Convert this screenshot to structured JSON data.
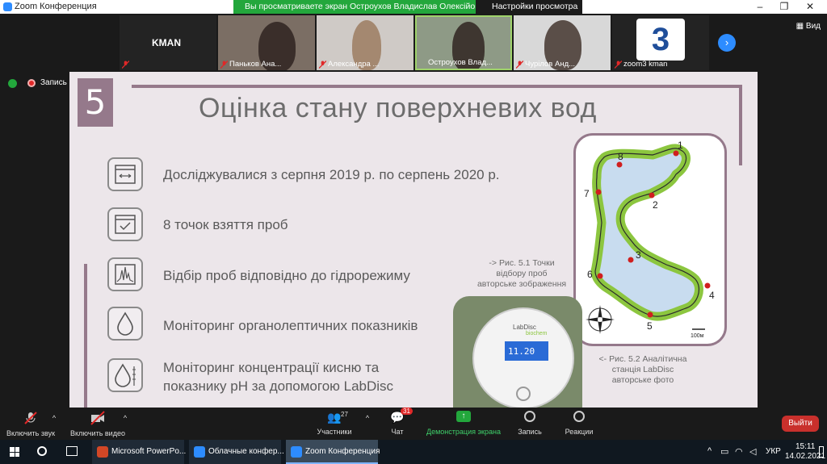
{
  "window": {
    "title": "Zoom Конференция"
  },
  "share_bar": {
    "message": "Вы просматриваете экран Остроухов Владислав Олексійови...",
    "view_options": "Настройки просмотра"
  },
  "gallery": {
    "tiles": [
      {
        "name": "KMAN"
      },
      {
        "name": "Паньков Ана..."
      },
      {
        "name": "Александра ..."
      },
      {
        "name": "Остроухов Влад..."
      },
      {
        "name": "Чурілов Анд..."
      },
      {
        "name": "zoom3 kman"
      }
    ],
    "view_label": "Вид"
  },
  "status": {
    "record_label": "Запись"
  },
  "slide": {
    "number": "5",
    "title": "Оцінка стану поверхневих вод",
    "items": [
      "Досліджувалися з серпня 2019 р. по серпень 2020 р.",
      "8 точок взяття проб",
      "Відбір проб відповідно до гідрорежиму",
      "Моніторинг органолептичних показників",
      "Моніторинг концентрації кисню та",
      "показнику рН за допомогою LabDisc"
    ],
    "caption1": [
      "-> Рис. 5.1 Точки",
      "відбору проб",
      "авторське зображення"
    ],
    "caption2": [
      "<- Рис. 5.2 Аналітична",
      "станція LabDisc",
      "авторське фото"
    ],
    "map_points": [
      "1",
      "2",
      "3",
      "4",
      "5",
      "6",
      "7",
      "8"
    ],
    "scale_label": "100м",
    "device": {
      "brand": "LabDisc",
      "sub": "biochem",
      "reading": "11.20"
    }
  },
  "toolbar": {
    "mute": "Включить звук",
    "video": "Включить видео",
    "participants": "Участники",
    "participants_count": "27",
    "chat": "Чат",
    "chat_badge": "31",
    "share": "Демонстрация экрана",
    "record": "Запись",
    "reactions": "Реакции",
    "leave": "Выйти"
  },
  "taskbar": {
    "apps": [
      "Microsoft PowerPo...",
      "Облачные конфер...",
      "Zoom Конференция"
    ],
    "lang": "УКР",
    "time": "15:11",
    "date": "14.02.2021"
  },
  "colors": {
    "accent": "#95798b",
    "share_green": "#23a73c",
    "leave_red": "#c9302c",
    "slide_bg": "#ece6ea"
  }
}
